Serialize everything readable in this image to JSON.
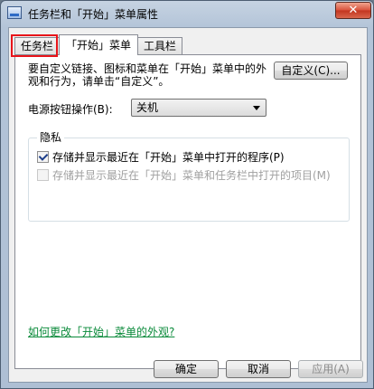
{
  "window": {
    "title": "任务栏和「开始」菜单属性",
    "close_label": "✕"
  },
  "tabs": [
    {
      "label": "任务栏"
    },
    {
      "label": "「开始」菜单"
    },
    {
      "label": "工具栏"
    }
  ],
  "start_menu": {
    "description": "要自定义链接、图标和菜单在「开始」菜单中的外观和行为，请单击“自定义”。",
    "customize_button": "自定义(C)...",
    "power_label": "电源按钮操作(B):",
    "power_value": "关机",
    "privacy_title": "隐私",
    "checkbox1_label": "存储并显示最近在「开始」菜单中打开的程序(P)",
    "checkbox2_label": "存储并显示最近在「开始」菜单和任务栏中打开的项目(M)",
    "help_link": "如何更改「开始」菜单的外观?"
  },
  "footer": {
    "ok": "确定",
    "cancel": "取消",
    "apply": "应用(A)"
  },
  "colors": {
    "highlight": "#e8141a",
    "link": "#0a8a3a"
  }
}
